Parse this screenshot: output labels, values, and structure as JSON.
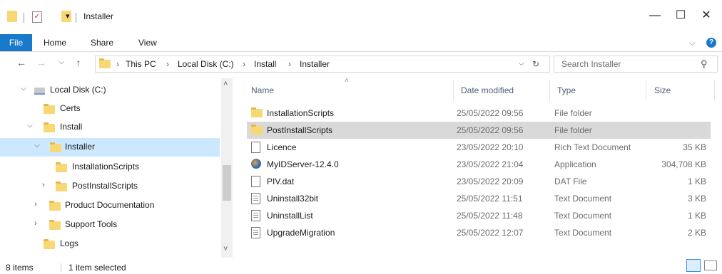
{
  "window": {
    "title": "Installer",
    "minimize": "—",
    "maximize": "☐",
    "close": "✕",
    "qa_dropdown": "▾"
  },
  "ribbon": {
    "tabs": [
      "File",
      "Home",
      "Share",
      "View"
    ],
    "collapse": "⌵",
    "help": "?"
  },
  "address": {
    "back": "←",
    "forward": "→",
    "recent": "⌵",
    "up": "↑",
    "crumbs": [
      "This PC",
      "Local Disk (C:)",
      "Install",
      "Installer"
    ],
    "sep": "›",
    "dropdown": "⌵",
    "refresh": "↻"
  },
  "search": {
    "placeholder": "Search Installer",
    "icon": "⚲"
  },
  "nav": {
    "items": [
      {
        "label": "Local Disk (C:)",
        "expander": "⌵",
        "icon": "drive-icon"
      },
      {
        "label": "Certs",
        "expander": "",
        "icon": "folder-icon"
      },
      {
        "label": "Install",
        "expander": "⌵",
        "icon": "folder-icon"
      },
      {
        "label": "Installer",
        "expander": "⌵",
        "icon": "folder-icon"
      },
      {
        "label": "InstallationScripts",
        "expander": "",
        "icon": "folder-icon"
      },
      {
        "label": "PostInstallScripts",
        "expander": "›",
        "icon": "folder-icon"
      },
      {
        "label": "Product Documentation",
        "expander": "›",
        "icon": "folder-icon"
      },
      {
        "label": "Support Tools",
        "expander": "›",
        "icon": "folder-icon"
      },
      {
        "label": "Logs",
        "expander": "",
        "icon": "folder-icon"
      }
    ],
    "scroll_up": "˄",
    "scroll_down": "˅"
  },
  "columns": {
    "name": "Name",
    "date": "Date modified",
    "type": "Type",
    "size": "Size",
    "sort_indicator": "˄"
  },
  "files": [
    {
      "name": "InstallationScripts",
      "date": "25/05/2022 09:56",
      "type": "File folder",
      "size": "",
      "icon": "folder-icon"
    },
    {
      "name": "PostInstallScripts",
      "date": "25/05/2022 09:56",
      "type": "File folder",
      "size": "",
      "icon": "folder-icon"
    },
    {
      "name": "Licence",
      "date": "23/05/2022 20:10",
      "type": "Rich Text Document",
      "size": "35 KB",
      "icon": "rtf-icon"
    },
    {
      "name": "MyIDServer-12.4.0",
      "date": "23/05/2022 21:04",
      "type": "Application",
      "size": "304,708 KB",
      "icon": "app-icon"
    },
    {
      "name": "PIV.dat",
      "date": "23/05/2022 20:09",
      "type": "DAT File",
      "size": "1 KB",
      "icon": "dat-icon"
    },
    {
      "name": "Uninstall32bit",
      "date": "25/05/2022 11:51",
      "type": "Text Document",
      "size": "3 KB",
      "icon": "text-doc-icon"
    },
    {
      "name": "UninstallList",
      "date": "25/05/2022 11:48",
      "type": "Text Document",
      "size": "1 KB",
      "icon": "text-doc-icon"
    },
    {
      "name": "UpgradeMigration",
      "date": "25/05/2022 12:07",
      "type": "Text Document",
      "size": "2 KB",
      "icon": "text-doc-icon"
    }
  ],
  "selected_file": 1,
  "status": {
    "count": "8 items",
    "selected": "1 item selected"
  },
  "colors": {
    "accent": "#1979ca",
    "selection": "#cce8ff",
    "row_selection": "#d9d9d9",
    "folder": "#f8d775"
  }
}
